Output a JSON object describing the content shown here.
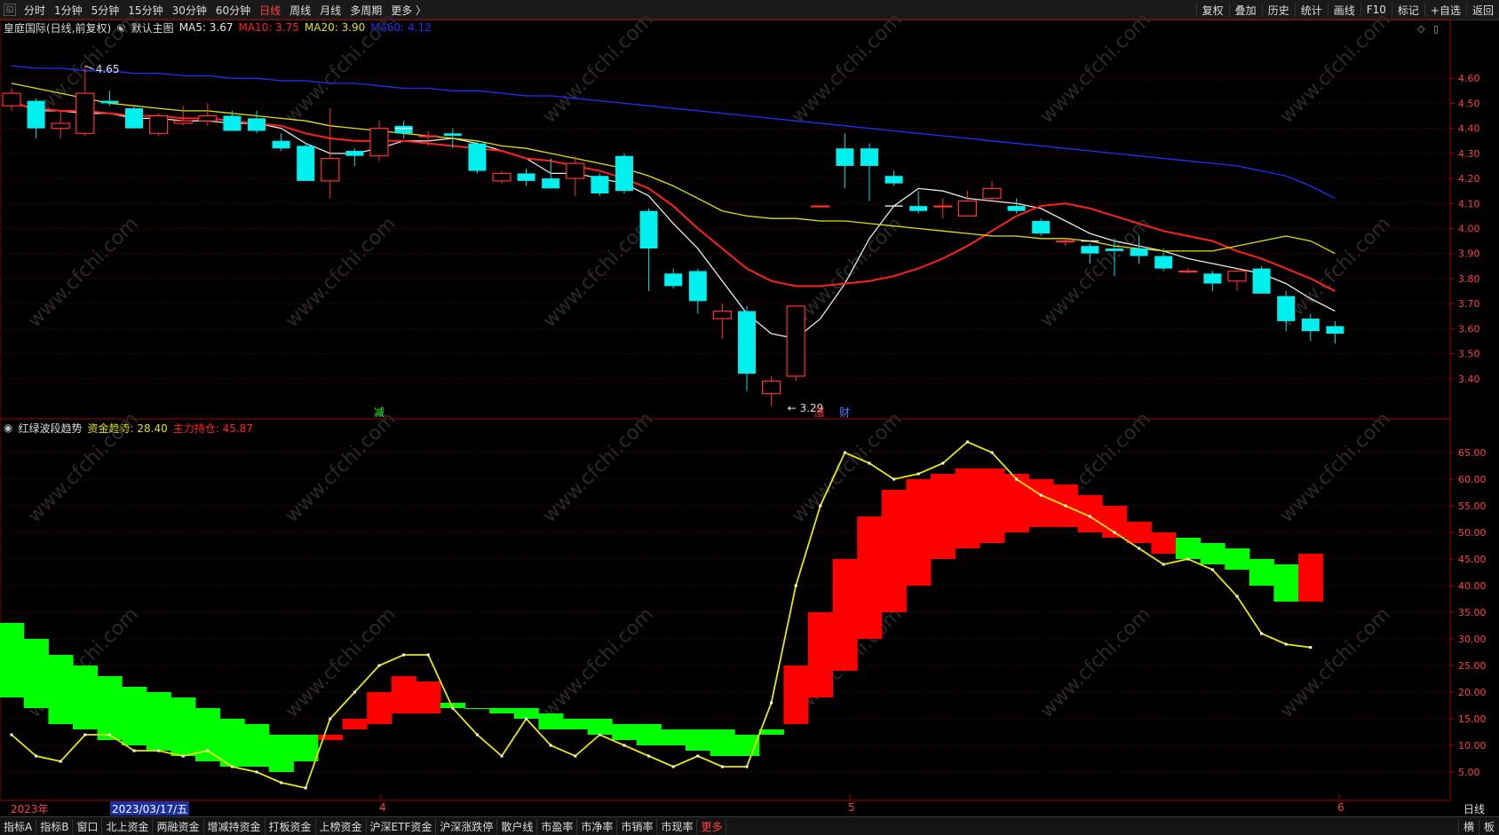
{
  "topbar": {
    "tabs": [
      "分时",
      "1分钟",
      "5分钟",
      "15分钟",
      "30分钟",
      "60分钟",
      "日线",
      "周线",
      "月线",
      "多周期",
      "更多 〉"
    ],
    "active_tab": "日线",
    "right_buttons": [
      "复权",
      "叠加",
      "历史",
      "统计",
      "画线",
      "F10",
      "标记",
      "+自选",
      "返回"
    ]
  },
  "main_chart": {
    "stock": "皇庭国际(日线,前复权)",
    "indicator_name": "默认主图",
    "ma5_label": "MA5: 3.67",
    "ma10_label": "MA10: 3.75",
    "ma20_label": "MA20: 3.90",
    "ma60_label": "MA60: 4.12",
    "high_label": "4.65",
    "low_label": "3.29",
    "markers": [
      "减",
      "涨",
      "财"
    ],
    "y_ticks": [
      "4.60",
      "4.50",
      "4.40",
      "4.30",
      "4.20",
      "4.10",
      "4.00",
      "3.90",
      "3.80",
      "3.70",
      "3.60",
      "3.50",
      "3.40"
    ]
  },
  "sub_chart": {
    "indicator_name": "红绿波段趋势",
    "fund_label": "资金趋势: 28.40",
    "main_label": "主力持仓: 45.87",
    "y_ticks": [
      "65.00",
      "60.00",
      "55.00",
      "50.00",
      "45.00",
      "40.00",
      "35.00",
      "30.00",
      "25.00",
      "20.00",
      "15.00",
      "10.00",
      "5.00"
    ]
  },
  "xaxis": {
    "year": "2023年",
    "cursor_date": "2023/03/17/五",
    "months": [
      "4",
      "5",
      "6"
    ],
    "period": "日线"
  },
  "bottombar": {
    "items": [
      "指标A",
      "指标B",
      "窗口",
      "北上资金",
      "两融资金",
      "增减持资金",
      "打板资金",
      "上榜资金",
      "沪深ETF资金",
      "沪深涨跌停",
      "散户线",
      "市盈率",
      "市净率",
      "市销率",
      "市现率",
      "更多"
    ],
    "right_items": [
      "横",
      "板"
    ]
  },
  "watermark": "www.cfchi.com",
  "chart_data": {
    "type": "candlestick",
    "price_ylim": [
      3.3,
      4.7
    ],
    "candles": [
      {
        "o": 4.49,
        "h": 4.56,
        "l": 4.47,
        "c": 4.54
      },
      {
        "o": 4.51,
        "h": 4.52,
        "l": 4.36,
        "c": 4.4
      },
      {
        "o": 4.4,
        "h": 4.47,
        "l": 4.36,
        "c": 4.42
      },
      {
        "o": 4.38,
        "h": 4.65,
        "l": 4.37,
        "c": 4.54
      },
      {
        "o": 4.51,
        "h": 4.55,
        "l": 4.49,
        "c": 4.5
      },
      {
        "o": 4.48,
        "h": 4.49,
        "l": 4.4,
        "c": 4.4
      },
      {
        "o": 4.38,
        "h": 4.46,
        "l": 4.37,
        "c": 4.45
      },
      {
        "o": 4.42,
        "h": 4.49,
        "l": 4.41,
        "c": 4.43
      },
      {
        "o": 4.43,
        "h": 4.5,
        "l": 4.41,
        "c": 4.45
      },
      {
        "o": 4.45,
        "h": 4.47,
        "l": 4.39,
        "c": 4.39
      },
      {
        "o": 4.44,
        "h": 4.47,
        "l": 4.38,
        "c": 4.39
      },
      {
        "o": 4.35,
        "h": 4.38,
        "l": 4.31,
        "c": 4.32
      },
      {
        "o": 4.33,
        "h": 4.34,
        "l": 4.19,
        "c": 4.19
      },
      {
        "o": 4.19,
        "h": 4.48,
        "l": 4.12,
        "c": 4.28
      },
      {
        "o": 4.31,
        "h": 4.32,
        "l": 4.25,
        "c": 4.29
      },
      {
        "o": 4.29,
        "h": 4.43,
        "l": 4.27,
        "c": 4.4
      },
      {
        "o": 4.41,
        "h": 4.43,
        "l": 4.36,
        "c": 4.38
      },
      {
        "o": 4.37,
        "h": 4.39,
        "l": 4.33,
        "c": 4.37
      },
      {
        "o": 4.38,
        "h": 4.4,
        "l": 4.32,
        "c": 4.37
      },
      {
        "o": 4.34,
        "h": 4.35,
        "l": 4.22,
        "c": 4.23
      },
      {
        "o": 4.19,
        "h": 4.23,
        "l": 4.18,
        "c": 4.22
      },
      {
        "o": 4.22,
        "h": 4.24,
        "l": 4.17,
        "c": 4.19
      },
      {
        "o": 4.2,
        "h": 4.28,
        "l": 4.16,
        "c": 4.16
      },
      {
        "o": 4.2,
        "h": 4.29,
        "l": 4.13,
        "c": 4.26
      },
      {
        "o": 4.21,
        "h": 4.22,
        "l": 4.13,
        "c": 4.14
      },
      {
        "o": 4.29,
        "h": 4.3,
        "l": 4.14,
        "c": 4.15
      },
      {
        "o": 4.07,
        "h": 4.08,
        "l": 3.75,
        "c": 3.92
      },
      {
        "o": 3.82,
        "h": 3.84,
        "l": 3.76,
        "c": 3.77
      },
      {
        "o": 3.83,
        "h": 3.84,
        "l": 3.66,
        "c": 3.71
      },
      {
        "o": 3.64,
        "h": 3.7,
        "l": 3.56,
        "c": 3.67
      },
      {
        "o": 3.67,
        "h": 3.69,
        "l": 3.35,
        "c": 3.42
      },
      {
        "o": 3.34,
        "h": 3.41,
        "l": 3.29,
        "c": 3.39
      },
      {
        "o": 3.41,
        "h": 3.69,
        "l": 3.39,
        "c": 3.69
      },
      {
        "o": 4.09,
        "h": 4.09,
        "l": 4.09,
        "c": 4.09
      },
      {
        "o": 4.32,
        "h": 4.38,
        "l": 4.16,
        "c": 4.25
      },
      {
        "o": 4.32,
        "h": 4.34,
        "l": 4.11,
        "c": 4.25
      },
      {
        "o": 4.21,
        "h": 4.23,
        "l": 4.17,
        "c": 4.18
      },
      {
        "o": 4.09,
        "h": 4.15,
        "l": 4.06,
        "c": 4.07
      },
      {
        "o": 4.09,
        "h": 4.12,
        "l": 4.04,
        "c": 4.09
      },
      {
        "o": 4.05,
        "h": 4.15,
        "l": 4.05,
        "c": 4.11
      },
      {
        "o": 4.12,
        "h": 4.19,
        "l": 4.11,
        "c": 4.16
      },
      {
        "o": 4.09,
        "h": 4.12,
        "l": 4.06,
        "c": 4.07
      },
      {
        "o": 4.03,
        "h": 4.04,
        "l": 3.97,
        "c": 3.98
      },
      {
        "o": 3.95,
        "h": 3.96,
        "l": 3.93,
        "c": 3.95
      },
      {
        "o": 3.93,
        "h": 3.94,
        "l": 3.86,
        "c": 3.9
      },
      {
        "o": 3.92,
        "h": 3.96,
        "l": 3.81,
        "c": 3.91
      },
      {
        "o": 3.92,
        "h": 3.97,
        "l": 3.86,
        "c": 3.89
      },
      {
        "o": 3.89,
        "h": 3.92,
        "l": 3.83,
        "c": 3.84
      },
      {
        "o": 3.83,
        "h": 3.84,
        "l": 3.82,
        "c": 3.83
      },
      {
        "o": 3.82,
        "h": 3.83,
        "l": 3.75,
        "c": 3.78
      },
      {
        "o": 3.79,
        "h": 3.84,
        "l": 3.75,
        "c": 3.83
      },
      {
        "o": 3.84,
        "h": 3.85,
        "l": 3.74,
        "c": 3.74
      },
      {
        "o": 3.73,
        "h": 3.75,
        "l": 3.59,
        "c": 3.63
      },
      {
        "o": 3.64,
        "h": 3.66,
        "l": 3.55,
        "c": 3.59
      },
      {
        "o": 3.61,
        "h": 3.63,
        "l": 3.54,
        "c": 3.58
      }
    ],
    "series": [
      {
        "name": "MA5",
        "color": "#e8e8e8",
        "values": [
          4.51,
          4.47,
          4.47,
          4.46,
          4.46,
          4.44,
          4.44,
          4.43,
          4.43,
          4.42,
          4.42,
          4.4,
          4.34,
          4.3,
          4.3,
          4.32,
          4.35,
          4.35,
          4.36,
          4.34,
          4.31,
          4.28,
          4.22,
          4.22,
          4.2,
          4.18,
          4.13,
          4.02,
          3.92,
          3.79,
          3.66,
          3.58,
          3.56,
          3.64,
          3.78,
          3.96,
          4.09,
          4.16,
          4.15,
          4.12,
          4.11,
          4.1,
          4.08,
          4.03,
          3.98,
          3.95,
          3.93,
          3.91,
          3.88,
          3.86,
          3.84,
          3.82,
          3.78,
          3.72,
          3.67
        ]
      },
      {
        "name": "MA10",
        "color": "#ff2020",
        "values": [
          4.5,
          4.48,
          4.47,
          4.47,
          4.46,
          4.45,
          4.45,
          4.44,
          4.44,
          4.43,
          4.42,
          4.41,
          4.38,
          4.36,
          4.35,
          4.35,
          4.35,
          4.34,
          4.33,
          4.32,
          4.31,
          4.28,
          4.27,
          4.25,
          4.23,
          4.2,
          4.16,
          4.09,
          4.0,
          3.92,
          3.84,
          3.79,
          3.77,
          3.77,
          3.78,
          3.79,
          3.81,
          3.84,
          3.88,
          3.93,
          3.99,
          4.05,
          4.09,
          4.1,
          4.08,
          4.05,
          4.02,
          3.99,
          3.97,
          3.95,
          3.91,
          3.88,
          3.84,
          3.8,
          3.75
        ]
      },
      {
        "name": "MA20",
        "color": "#e0e000",
        "values": [
          4.58,
          4.56,
          4.54,
          4.52,
          4.5,
          4.49,
          4.48,
          4.47,
          4.47,
          4.46,
          4.45,
          4.44,
          4.43,
          4.41,
          4.4,
          4.39,
          4.38,
          4.37,
          4.36,
          4.35,
          4.33,
          4.32,
          4.3,
          4.28,
          4.26,
          4.24,
          4.21,
          4.17,
          4.12,
          4.07,
          4.05,
          4.04,
          4.04,
          4.03,
          4.03,
          4.02,
          4.01,
          4.0,
          3.99,
          3.98,
          3.97,
          3.97,
          3.96,
          3.96,
          3.95,
          3.93,
          3.92,
          3.91,
          3.91,
          3.91,
          3.93,
          3.95,
          3.97,
          3.95,
          3.9
        ]
      },
      {
        "name": "MA60",
        "color": "#2030ff",
        "values": [
          4.65,
          4.64,
          4.64,
          4.63,
          4.63,
          4.62,
          4.62,
          4.61,
          4.61,
          4.6,
          4.6,
          4.59,
          4.59,
          4.58,
          4.58,
          4.57,
          4.56,
          4.56,
          4.55,
          4.55,
          4.54,
          4.53,
          4.53,
          4.52,
          4.51,
          4.5,
          4.49,
          4.48,
          4.47,
          4.46,
          4.45,
          4.44,
          4.43,
          4.42,
          4.41,
          4.4,
          4.39,
          4.38,
          4.37,
          4.36,
          4.35,
          4.34,
          4.33,
          4.32,
          4.31,
          4.3,
          4.29,
          4.28,
          4.27,
          4.26,
          4.25,
          4.23,
          4.21,
          4.17,
          4.12
        ]
      }
    ],
    "sub_ylim": [
      0,
      70
    ],
    "fund_trend": [
      12,
      8,
      7,
      12,
      12,
      9,
      9,
      8,
      9,
      6,
      5,
      3,
      2,
      15,
      20,
      25,
      27,
      27,
      17,
      12,
      8,
      15,
      10,
      8,
      12,
      10,
      8,
      6,
      8,
      6,
      6,
      18,
      40,
      55,
      65,
      63,
      60,
      61,
      63,
      67,
      65,
      60,
      57,
      55,
      53,
      50,
      47,
      44,
      45,
      43,
      38,
      31,
      29,
      28.4
    ],
    "band_top": [
      33,
      30,
      27,
      25,
      23,
      21,
      20,
      19,
      17,
      15,
      14,
      12,
      12,
      11,
      15,
      20,
      23,
      22,
      18,
      17,
      17,
      17,
      16,
      15,
      15,
      14,
      14,
      13,
      13,
      13,
      12,
      12,
      25,
      35,
      45,
      53,
      58,
      60,
      61,
      62,
      62,
      61,
      60,
      59,
      57,
      55,
      52,
      50,
      49,
      48,
      47,
      45,
      44,
      46
    ],
    "band_bottom": [
      19,
      17,
      14,
      13,
      11,
      10,
      9,
      8,
      7,
      6,
      6,
      5,
      7,
      12,
      13,
      14,
      16,
      16,
      17,
      17,
      16,
      15,
      13,
      13,
      12,
      11,
      10,
      10,
      9,
      8,
      8,
      13,
      14,
      19,
      24,
      30,
      35,
      40,
      45,
      47,
      48,
      50,
      51,
      51,
      50,
      49,
      48,
      46,
      45,
      44,
      43,
      40,
      37,
      37
    ]
  }
}
